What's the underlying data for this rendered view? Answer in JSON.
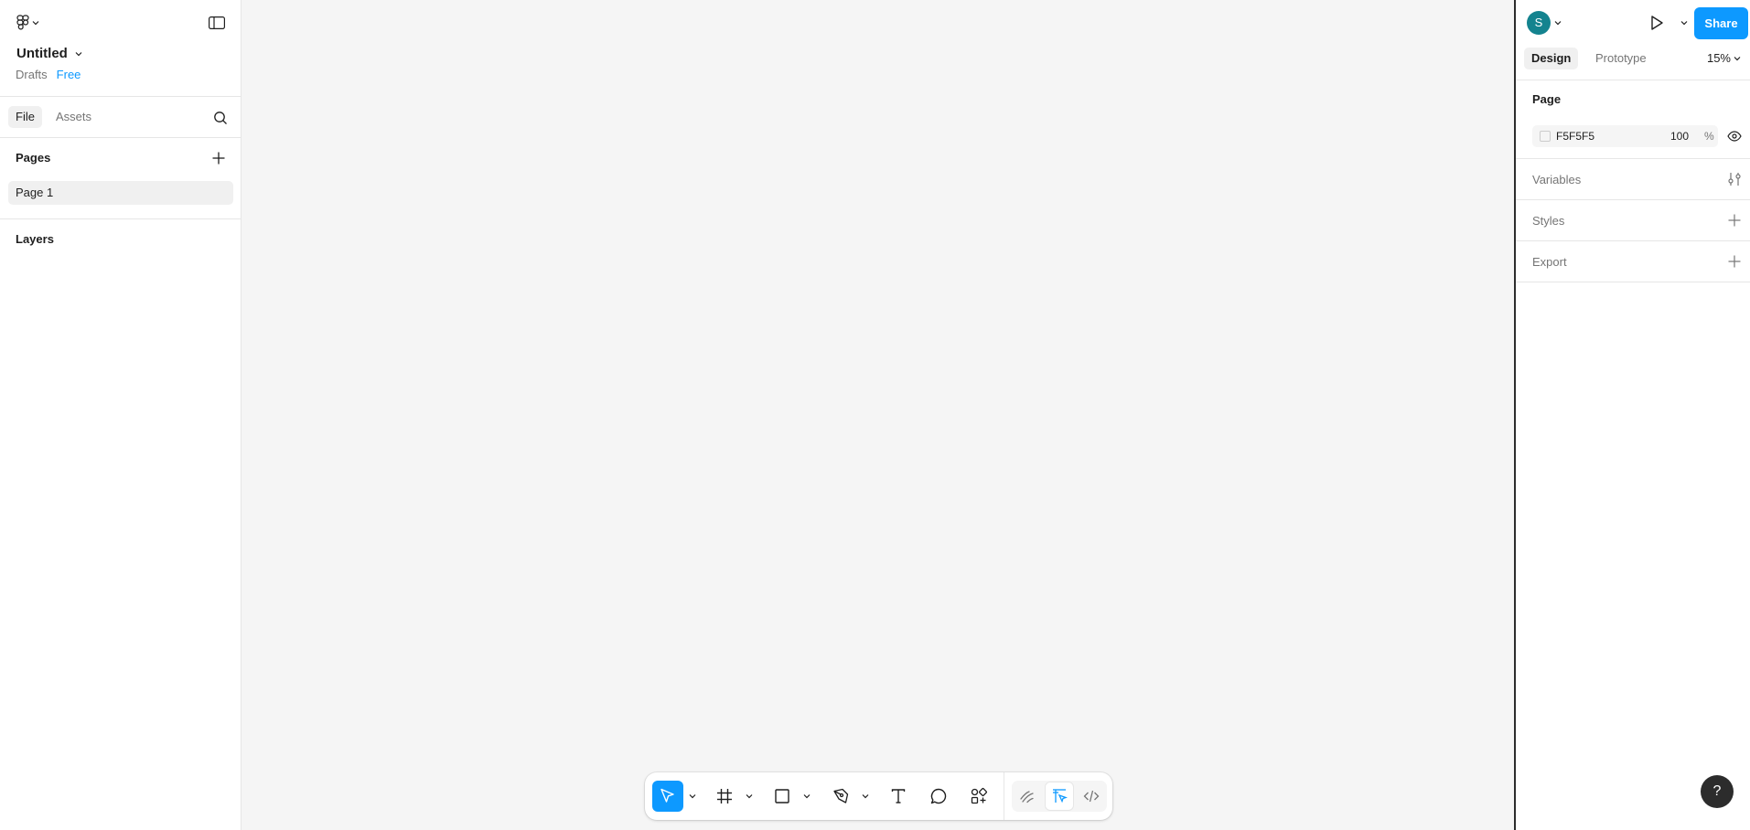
{
  "file": {
    "title": "Untitled",
    "location": "Drafts",
    "plan": "Free"
  },
  "left_panel": {
    "tabs": [
      "File",
      "Assets"
    ],
    "pages_title": "Pages",
    "pages": [
      "Page 1"
    ],
    "layers_title": "Layers"
  },
  "right_panel": {
    "avatar_initial": "S",
    "share_label": "Share",
    "tabs": [
      "Design",
      "Prototype"
    ],
    "zoom": "15%",
    "page_section_title": "Page",
    "page_color_hex": "F5F5F5",
    "page_opacity": "100",
    "opacity_unit": "%",
    "rows": [
      "Variables",
      "Styles",
      "Export"
    ]
  },
  "help_label": "?",
  "colors": {
    "accent": "#0d99ff",
    "avatar": "#14838f",
    "canvas": "#f5f5f5"
  },
  "icons": {
    "toolbar": [
      "move-icon",
      "frame-icon",
      "rectangle-icon",
      "pen-icon",
      "text-icon",
      "comment-icon",
      "actions-icon",
      "draw-mode-icon",
      "design-mode-icon",
      "dev-mode-icon"
    ]
  }
}
